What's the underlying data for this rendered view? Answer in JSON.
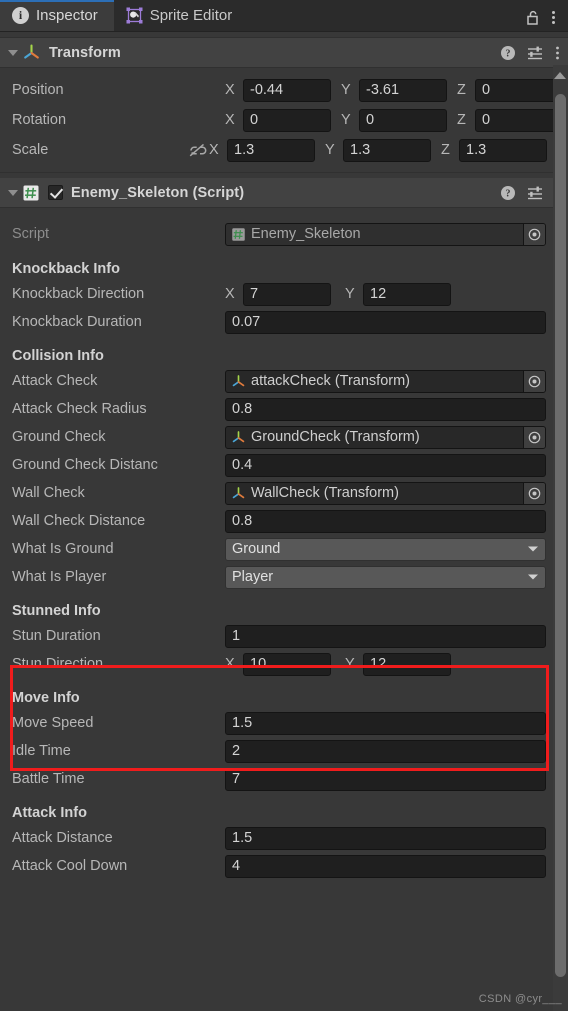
{
  "window": {
    "tabs": [
      {
        "label": "Inspector",
        "icon": "info-icon",
        "active": true
      },
      {
        "label": "Sprite Editor",
        "icon": "sprite-editor-icon",
        "active": false
      }
    ],
    "lock_icon": "unlocked-padlock-icon",
    "menu_icon": "kebab-menu-icon"
  },
  "transform": {
    "title": "Transform",
    "icon": "transform-gizmo-icon",
    "help_icon": "help-icon",
    "preset_icon": "preset-settings-icon",
    "menu_icon": "kebab-menu-icon",
    "rows": [
      {
        "label": "Position",
        "axes": [
          {
            "axis": "X",
            "value": "-0.44"
          },
          {
            "axis": "Y",
            "value": "-3.61"
          },
          {
            "axis": "Z",
            "value": "0"
          }
        ]
      },
      {
        "label": "Rotation",
        "axes": [
          {
            "axis": "X",
            "value": "0"
          },
          {
            "axis": "Y",
            "value": "0"
          },
          {
            "axis": "Z",
            "value": "0"
          }
        ]
      },
      {
        "label": "Scale",
        "link_icon": "constrain-proportions-off-icon",
        "axes": [
          {
            "axis": "X",
            "value": "1.3"
          },
          {
            "axis": "Y",
            "value": "1.3"
          },
          {
            "axis": "Z",
            "value": "1.3"
          }
        ]
      }
    ]
  },
  "script_component": {
    "title": "Enemy_Skeleton (Script)",
    "icon": "cs-script-icon",
    "enabled": true,
    "help_icon": "help-icon",
    "preset_icon": "preset-settings-icon",
    "menu_icon": "kebab-menu-icon",
    "script_field": {
      "label": "Script",
      "value": "Enemy_Skeleton",
      "icon": "cs-script-icon",
      "picker_icon": "object-picker-icon"
    },
    "groups": [
      {
        "title": "Knockback Info",
        "fields": [
          {
            "type": "vector2",
            "label": "Knockback Direction",
            "x": "7",
            "y": "12"
          },
          {
            "type": "number",
            "label": "Knockback Duration",
            "value": "0.07"
          }
        ]
      },
      {
        "title": "Collision Info",
        "fields": [
          {
            "type": "object",
            "label": "Attack Check",
            "value": "attackCheck (Transform)",
            "icon": "transform-gizmo-icon",
            "picker_icon": "object-picker-icon"
          },
          {
            "type": "number",
            "label": "Attack Check Radius",
            "value": "0.8"
          },
          {
            "type": "object",
            "label": "Ground Check",
            "value": "GroundCheck (Transform)",
            "icon": "transform-gizmo-icon",
            "picker_icon": "object-picker-icon"
          },
          {
            "type": "number",
            "label": "Ground Check Distanc",
            "value": "0.4"
          },
          {
            "type": "object",
            "label": "Wall Check",
            "value": "WallCheck (Transform)",
            "icon": "transform-gizmo-icon",
            "picker_icon": "object-picker-icon"
          },
          {
            "type": "number",
            "label": "Wall Check Distance",
            "value": "0.8"
          },
          {
            "type": "dropdown",
            "label": "What Is Ground",
            "value": "Ground",
            "caret_icon": "chevron-down-icon"
          },
          {
            "type": "dropdown",
            "label": "What Is Player",
            "value": "Player",
            "caret_icon": "chevron-down-icon"
          }
        ]
      },
      {
        "title": "Stunned Info",
        "highlighted": true,
        "highlight_color": "#f01c1c",
        "fields": [
          {
            "type": "number",
            "label": "Stun Duration",
            "value": "1"
          },
          {
            "type": "vector2",
            "label": "Stun Direction",
            "x": "10",
            "y": "12"
          }
        ]
      },
      {
        "title": "Move Info",
        "fields": [
          {
            "type": "number",
            "label": "Move Speed",
            "value": "1.5"
          },
          {
            "type": "number",
            "label": "Idle Time",
            "value": "2"
          },
          {
            "type": "number",
            "label": "Battle Time",
            "value": "7"
          }
        ]
      },
      {
        "title": "Attack Info",
        "fields": [
          {
            "type": "number",
            "label": "Attack Distance",
            "value": "1.5"
          },
          {
            "type": "number",
            "label": "Attack Cool Down",
            "value": "4"
          }
        ]
      }
    ]
  },
  "watermark": "CSDN @cyr___",
  "colors": {
    "accent": "#2c6fb7",
    "panel": "#383838",
    "header": "#424242",
    "field": "#1f1f1f",
    "dropdown": "#585858"
  }
}
